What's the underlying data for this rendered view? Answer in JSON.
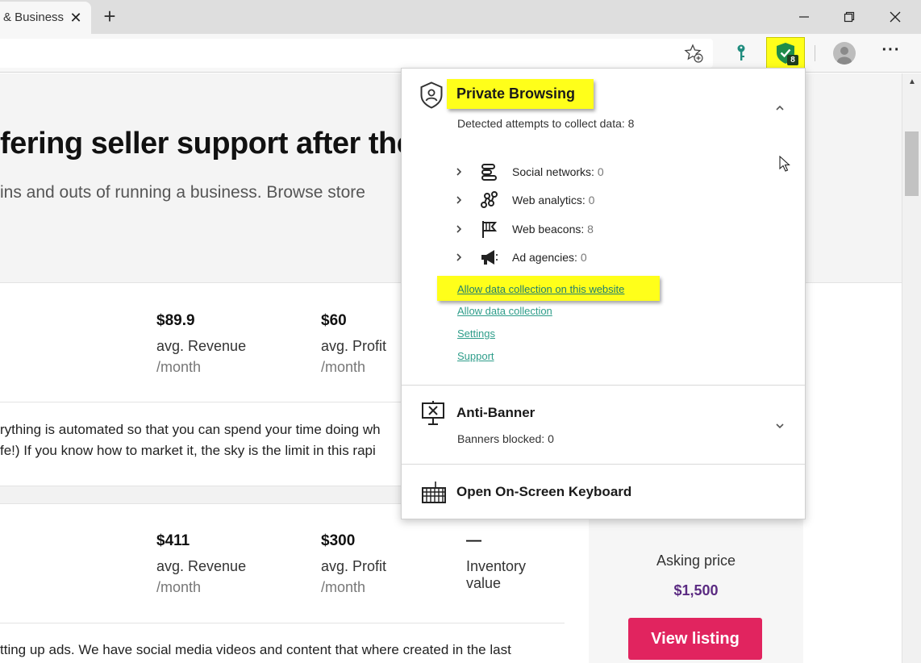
{
  "browser": {
    "tab_title": "& Business",
    "new_tab_label": "+",
    "extension_badge_count": "8",
    "more_label": "···",
    "icons": {
      "favorites": "star-plus-icon",
      "password": "key-icon",
      "extension": "shield-check-icon",
      "profile": "avatar",
      "minimize": "minimize-icon",
      "maximize": "restore-icon",
      "close": "close-icon"
    }
  },
  "page": {
    "hero_title": "fering seller support after the",
    "hero_subtitle": " ins and outs of running a business. Browse store",
    "listings": [
      {
        "metrics": [
          {
            "value": "$89.9",
            "label": "avg. Revenue",
            "period": "/month"
          },
          {
            "value": "$60",
            "label": "avg. Profit",
            "period": "/month"
          }
        ],
        "description_lines": [
          "rything is automated so that you can spend your time doing wh",
          "fe!) If you know how to market it, the sky is the limit in this rapi"
        ]
      },
      {
        "metrics": [
          {
            "value": "$411",
            "label": "avg. Revenue",
            "period": "/month"
          },
          {
            "value": "$300",
            "label": "avg. Profit",
            "period": "/month"
          },
          {
            "value": "—",
            "label": "Inventory value",
            "period": ""
          }
        ],
        "description_lines": [
          "tting up ads. We have social media videos and content that where created in the last"
        ]
      }
    ],
    "asking_price_label": "Asking price",
    "asking_price": "$1,500",
    "view_listing_label": "View listing"
  },
  "popup": {
    "private_browsing": {
      "title": "Private Browsing",
      "detected": "Detected attempts to collect data: 8",
      "categories": [
        {
          "label": "Social networks:",
          "count": "0",
          "icon": "social-networks-icon"
        },
        {
          "label": "Web analytics:",
          "count": "0",
          "icon": "web-analytics-icon"
        },
        {
          "label": "Web beacons:",
          "count": "8",
          "icon": "web-beacons-flag-icon"
        },
        {
          "label": "Ad agencies:",
          "count": "0",
          "icon": "ad-agencies-megaphone-icon"
        }
      ],
      "links": {
        "allow_site": "Allow data collection on this website",
        "allow_all": "Allow data collection",
        "settings": "Settings",
        "support": "Support"
      }
    },
    "anti_banner": {
      "title": "Anti-Banner",
      "blocked": "Banners blocked: 0"
    },
    "keyboard": {
      "title": "Open On-Screen Keyboard"
    }
  },
  "colors": {
    "highlight": "#ffff1a",
    "link": "#2e9d8a",
    "cta": "#e1245f",
    "price": "#5b2b82"
  }
}
